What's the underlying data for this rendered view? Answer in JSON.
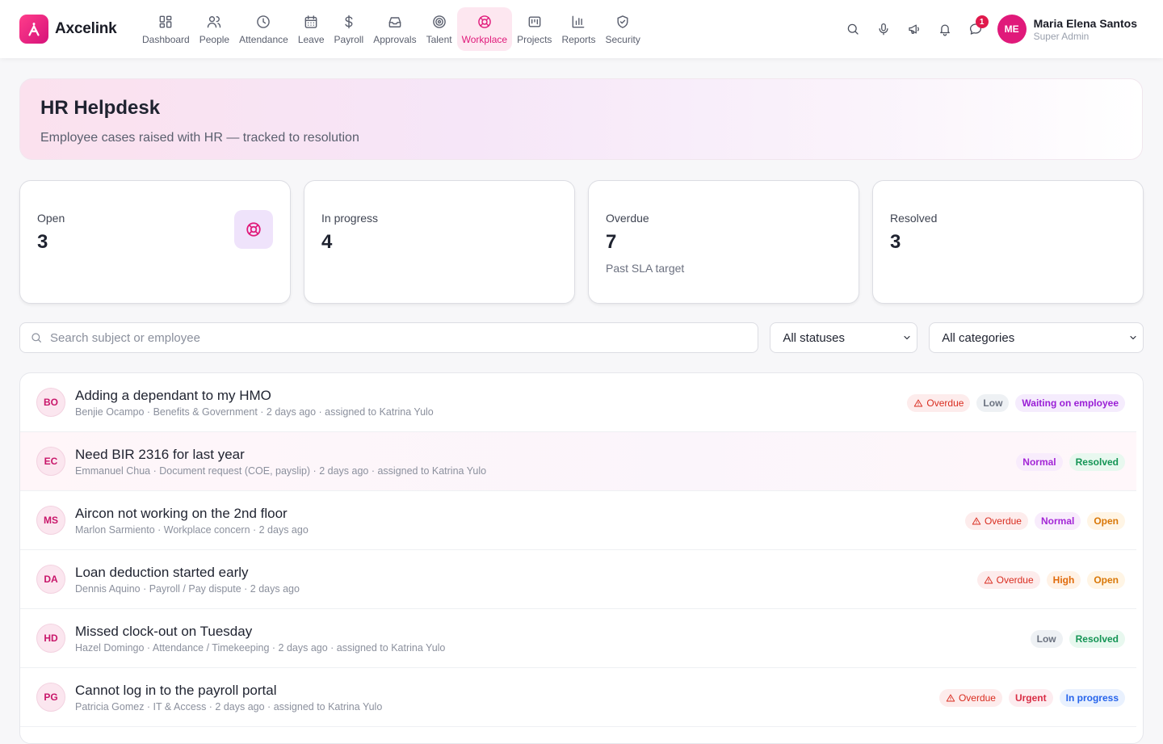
{
  "app": {
    "name": "Axcelink"
  },
  "nav": {
    "items": [
      {
        "label": "Dashboard",
        "icon": "dashboard-icon"
      },
      {
        "label": "People",
        "icon": "people-icon"
      },
      {
        "label": "Attendance",
        "icon": "clock-icon"
      },
      {
        "label": "Leave",
        "icon": "calendar-icon"
      },
      {
        "label": "Payroll",
        "icon": "dollar-icon"
      },
      {
        "label": "Approvals",
        "icon": "inbox-icon"
      },
      {
        "label": "Talent",
        "icon": "target-icon"
      },
      {
        "label": "Workplace",
        "icon": "lifebuoy-icon",
        "active": true
      },
      {
        "label": "Projects",
        "icon": "kanban-icon"
      },
      {
        "label": "Reports",
        "icon": "bar-chart-icon"
      },
      {
        "label": "Security",
        "icon": "shield-icon"
      }
    ]
  },
  "topbar": {
    "notification_count": "1",
    "user": {
      "initials": "ME",
      "name": "Maria Elena Santos",
      "role": "Super Admin"
    }
  },
  "hero": {
    "title": "HR Helpdesk",
    "subtitle": "Employee cases raised with HR — tracked to resolution"
  },
  "stats": [
    {
      "label": "Open",
      "value": "3"
    },
    {
      "label": "In progress",
      "value": "4"
    },
    {
      "label": "Overdue",
      "value": "7",
      "note": "Past SLA target"
    },
    {
      "label": "Resolved",
      "value": "3"
    }
  ],
  "filters": {
    "search_placeholder": "Search subject or employee",
    "status_value": "All statuses",
    "category_value": "All categories"
  },
  "cases": [
    {
      "initials": "BO",
      "title": "Adding a dependant to my HMO",
      "meta": "Benjie Ocampo · Benefits & Government · 2 days ago · assigned to Katrina Yulo",
      "overdue": "Overdue",
      "priority": "Low",
      "status": "Waiting on employee"
    },
    {
      "initials": "EC",
      "title": "Need BIR 2316 for last year",
      "meta": "Emmanuel Chua · Document request (COE, payslip) · 2 days ago · assigned to Katrina Yulo",
      "priority": "Normal",
      "status": "Resolved"
    },
    {
      "initials": "MS",
      "title": "Aircon not working on the 2nd floor",
      "meta": "Marlon Sarmiento · Workplace concern · 2 days ago",
      "overdue": "Overdue",
      "priority": "Normal",
      "status": "Open"
    },
    {
      "initials": "DA",
      "title": "Loan deduction started early",
      "meta": "Dennis Aquino · Payroll / Pay dispute · 2 days ago",
      "overdue": "Overdue",
      "priority": "High",
      "status": "Open"
    },
    {
      "initials": "HD",
      "title": "Missed clock-out on Tuesday",
      "meta": "Hazel Domingo · Attendance / Timekeeping · 2 days ago · assigned to Katrina Yulo",
      "priority": "Low",
      "status": "Resolved"
    },
    {
      "initials": "PG",
      "title": "Cannot log in to the payroll portal",
      "meta": "Patricia Gomez · IT & Access · 2 days ago · assigned to Katrina Yulo",
      "overdue": "Overdue",
      "priority": "Urgent",
      "status": "In progress"
    }
  ],
  "colors": {
    "accent": "#e0197a",
    "overdue": "#d92d20",
    "resolved": "#139454",
    "open": "#d97706",
    "in_progress": "#2563eb"
  }
}
